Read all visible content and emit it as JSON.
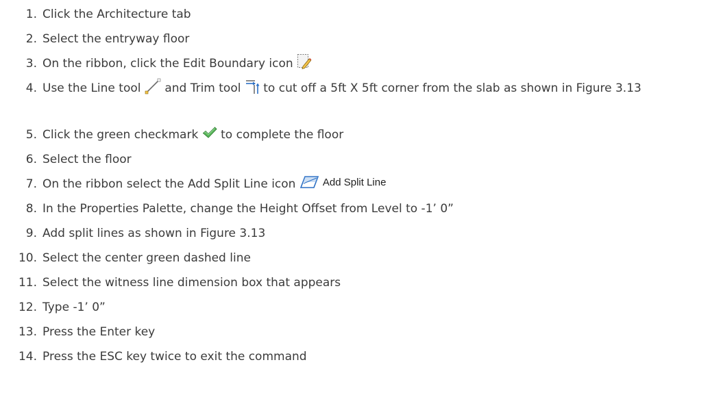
{
  "steps": [
    {
      "num": "1.",
      "text": "Click the Architecture tab"
    },
    {
      "num": "2.",
      "text": "Select the entryway floor"
    },
    {
      "num": "3.",
      "text_before": "On the ribbon, click the Edit Boundary icon",
      "icon": "edit-boundary-icon"
    },
    {
      "num": "4.",
      "text_a": "Use the Line tool",
      "icon_a": "line-tool-icon",
      "text_b": "and Trim tool",
      "icon_b": "trim-tool-icon",
      "text_c": "to cut off a 5ft X 5ft corner from the slab as shown in Figure 3.13"
    },
    {
      "num": "5.",
      "text_before": "Click the green checkmark",
      "icon": "green-checkmark-icon",
      "text_after": "to complete the floor"
    },
    {
      "num": "6.",
      "text": "Select the floor"
    },
    {
      "num": "7.",
      "text_before": "On the ribbon select the Add Split Line icon",
      "icon": "add-split-line-icon",
      "icon_label": "Add Split Line"
    },
    {
      "num": "8.",
      "text": "In the Properties Palette, change the Height Offset from Level to -1’ 0”"
    },
    {
      "num": "9.",
      "text": "Add split lines as shown in Figure 3.13"
    },
    {
      "num": "10.",
      "text": "Select the center green dashed line"
    },
    {
      "num": "11.",
      "text": "Select the witness line dimension box that appears"
    },
    {
      "num": "12.",
      "text": "Type -1’ 0”"
    },
    {
      "num": "13.",
      "text": "Press the Enter key"
    },
    {
      "num": "14.",
      "text": "Press the ESC key twice to exit the command"
    }
  ],
  "colors": {
    "text": "#3b3b3b",
    "check": "#4caf50",
    "eraser": "#2b6fc4"
  }
}
